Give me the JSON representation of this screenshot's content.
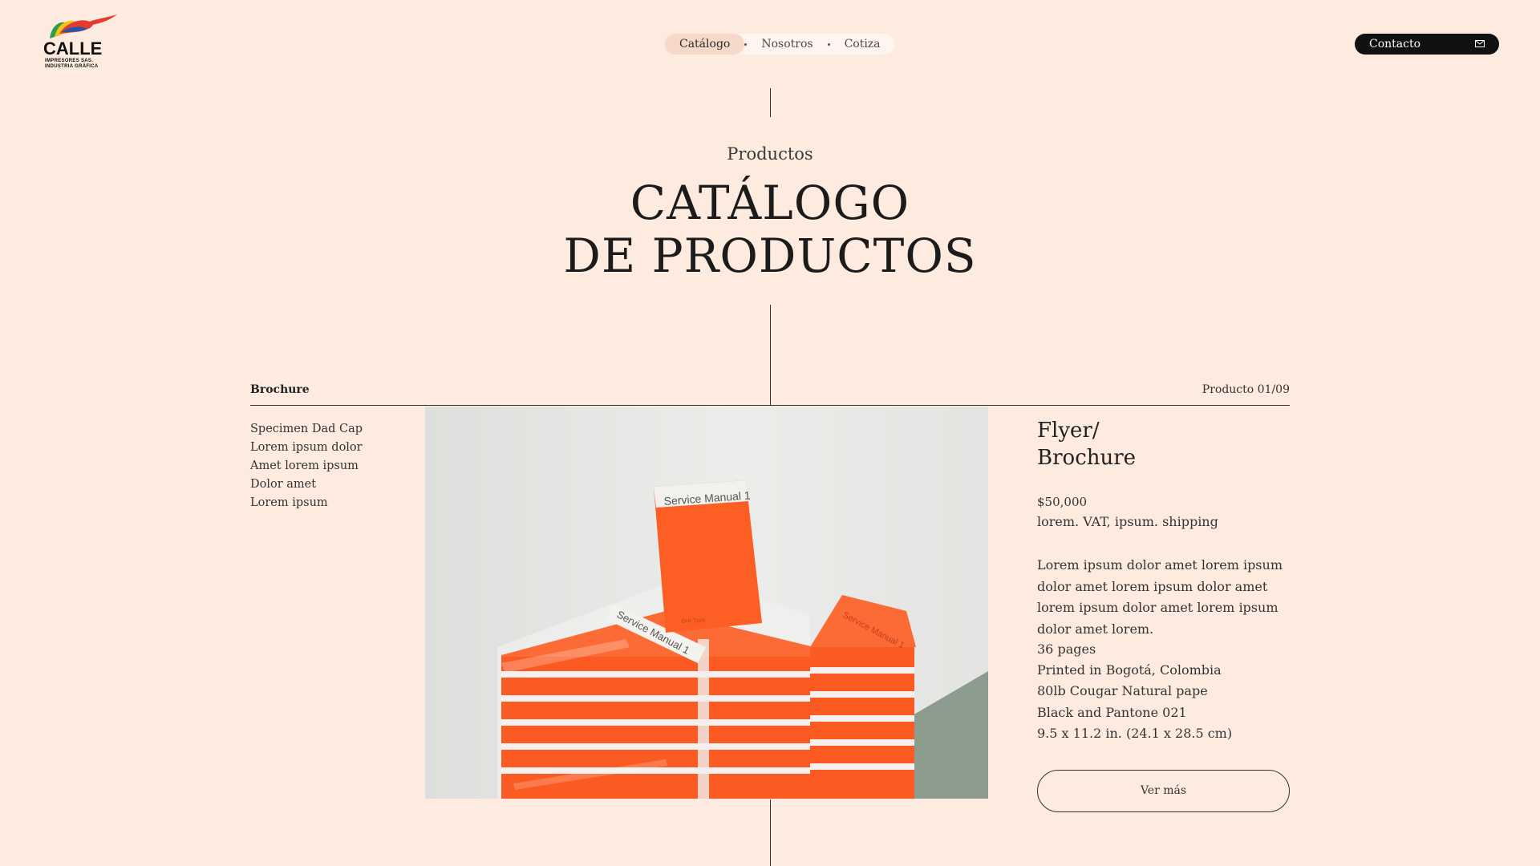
{
  "header": {
    "logo": {
      "wordmark": "CALLE",
      "line1": "IMPRESORES SAS.",
      "line2": "INDUSTRIA GRÁFICA",
      "colors": {
        "red": "#e53a2f",
        "yellow": "#f3c21a",
        "green": "#2e9e4a",
        "blue": "#2656a8"
      }
    },
    "nav": [
      {
        "label": "Catálogo",
        "active": true
      },
      {
        "label": "Nosotros",
        "active": false
      },
      {
        "label": "Cotiza",
        "active": false
      }
    ],
    "contact": {
      "label": "Contacto",
      "icon": "mail-icon"
    }
  },
  "hero": {
    "kicker": "Productos",
    "title_line1": "CATÁLOGO",
    "title_line2": "DE PRODUCTOS"
  },
  "section": {
    "category": "Brochure",
    "counter": "Producto 01/09",
    "subcategories": [
      "Specimen Dad Cap",
      "Lorem ipsum dolor",
      "Amet lorem ipsum",
      "Dolor amet",
      "Lorem ipsum"
    ]
  },
  "photo": {
    "standing_label": "Service Manual 1",
    "standing_sub": "Grill Type",
    "stack_label": "Service Manual 1",
    "stack_label_right": "Service Manual 1",
    "colors": {
      "orange": "#fb5a22",
      "wall": "#e6e6e3",
      "floor": "#8a9b8c"
    }
  },
  "product": {
    "name_line1": "Flyer/",
    "name_line2": "Brochure",
    "price": "$50,000",
    "vat": "lorem. VAT, ipsum. shipping",
    "description": "Lorem ipsum dolor amet lorem ipsum dolor amet lorem ipsum dolor amet lorem ipsum dolor amet lorem ipsum dolor amet lorem.",
    "specs": [
      "36 pages",
      "Printed in Bogotá, Colombia",
      "80lb Cougar Natural pape",
      "Black and Pantone 021",
      "9.5 x 11.2 in. (24.1 x 28.5 cm)"
    ],
    "more_label": "Ver más"
  }
}
